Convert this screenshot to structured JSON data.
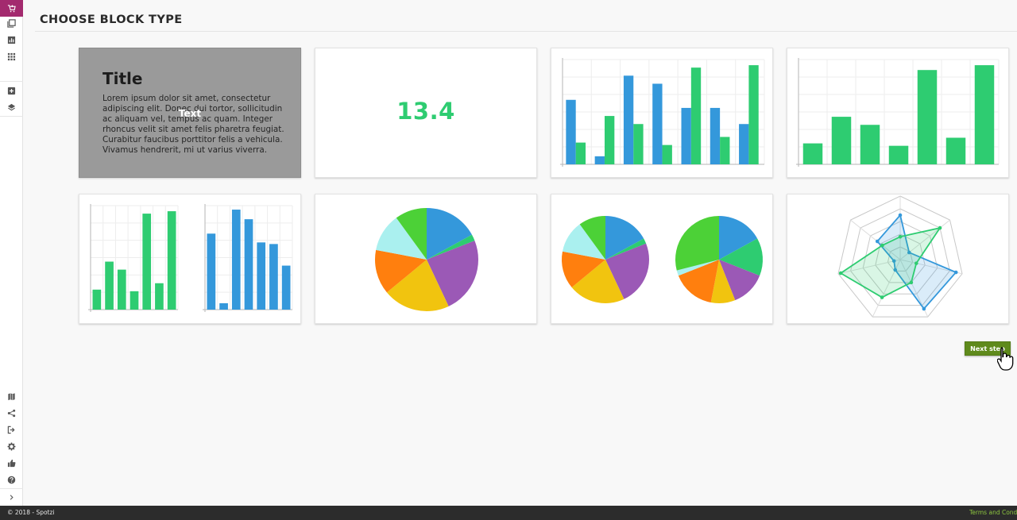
{
  "sidebar": {
    "top_items": [
      {
        "icon": "cart-plus-icon",
        "active": true
      },
      {
        "icon": "pages-icon",
        "active": false
      },
      {
        "icon": "bar-chart-icon",
        "active": false
      },
      {
        "icon": "grid-icon",
        "active": false
      }
    ],
    "middle_items": [
      {
        "icon": "add-box-icon"
      },
      {
        "icon": "layers-icon"
      }
    ],
    "bottom_items": [
      {
        "icon": "map-icon"
      },
      {
        "icon": "share-icon"
      },
      {
        "icon": "export-icon"
      },
      {
        "icon": "gear-icon"
      },
      {
        "icon": "thumbs-up-icon"
      },
      {
        "icon": "help-icon"
      },
      {
        "icon": "chevron-right-icon"
      }
    ]
  },
  "header": {
    "title": "CHOOSE BLOCK TYPE"
  },
  "blocks": {
    "text": {
      "title": "Title",
      "body": "Lorem ipsum dolor sit amet, consectetur adipiscing elit. Donec dui tortor, sollicitudin ac aliquam vel, tempus ac quam. Integer rhoncus velit sit amet felis pharetra feugiat. Curabitur faucibus porttitor felis a vehicula. Vivamus hendrerit, mi ut varius viverra.",
      "overlay_label": "Text",
      "selected": true
    },
    "number": {
      "value": "13.4"
    }
  },
  "colors": {
    "brand_active": "#a32a6e",
    "green": "#2ecc71",
    "blue": "#3498db",
    "button": "#5f8a1c",
    "footer_bg": "#2c2c2c",
    "footer_link": "#8dc63f"
  },
  "chart_data": [
    {
      "type": "bar",
      "series": [
        {
          "color": "#3498db",
          "values": [
            8,
            1,
            11,
            10,
            7,
            7,
            5
          ]
        },
        {
          "color": "#2ecc71",
          "values": [
            2.7,
            6,
            5,
            2.4,
            12,
            3.4,
            12.3
          ]
        }
      ],
      "ylim": [
        0,
        13
      ]
    },
    {
      "type": "bar",
      "series": [
        {
          "color": "#2ecc71",
          "values": [
            2.6,
            5.9,
            4.9,
            2.3,
            11.7,
            3.3,
            12.3
          ]
        }
      ],
      "ylim": [
        0,
        13
      ]
    },
    {
      "type": "bar",
      "series": [
        {
          "color": "#2ecc71",
          "values": [
            2.5,
            6,
            5,
            2.3,
            12,
            3.3,
            12.3
          ]
        }
      ],
      "ylim": [
        0,
        13
      ]
    },
    {
      "type": "bar",
      "series": [
        {
          "color": "#3498db",
          "values": [
            9.5,
            0.8,
            12.5,
            11.3,
            8.4,
            8.2,
            5.5
          ]
        }
      ],
      "ylim": [
        0,
        13
      ]
    },
    {
      "type": "pie",
      "values": [
        17,
        2,
        24,
        21,
        14,
        12,
        10
      ],
      "colors": [
        "#3498db",
        "#2ecc71",
        "#9b59b6",
        "#f1c40f",
        "#ff7f0e",
        "#aaf0ef",
        "#4cd137"
      ]
    },
    {
      "type": "pie",
      "values": [
        17,
        2,
        24,
        21,
        14,
        12,
        10
      ],
      "colors": [
        "#3498db",
        "#2ecc71",
        "#9b59b6",
        "#f1c40f",
        "#ff7f0e",
        "#aaf0ef",
        "#4cd137"
      ]
    },
    {
      "type": "pie",
      "values": [
        17,
        14,
        13,
        9,
        16,
        2,
        29
      ],
      "colors": [
        "#3498db",
        "#2ecc71",
        "#9b59b6",
        "#f1c40f",
        "#ff7f0e",
        "#aaf0ef",
        "#4cd137"
      ]
    },
    {
      "type": "radar",
      "axes": 7,
      "rmax": 5,
      "series": [
        {
          "color": "#3498db",
          "values": [
            3.5,
            0.9,
            4.5,
            4.3,
            0.9,
            0.5,
            2.3
          ]
        },
        {
          "color": "#2ecc71",
          "values": [
            1.8,
            4.0,
            1.3,
            2.0,
            3.3,
            4.8,
            1.8
          ]
        }
      ]
    }
  ],
  "actions": {
    "next_label": "Next step"
  },
  "footer": {
    "copyright": "© 2018 - Spotzi",
    "terms_label": "Terms and Conditions"
  }
}
